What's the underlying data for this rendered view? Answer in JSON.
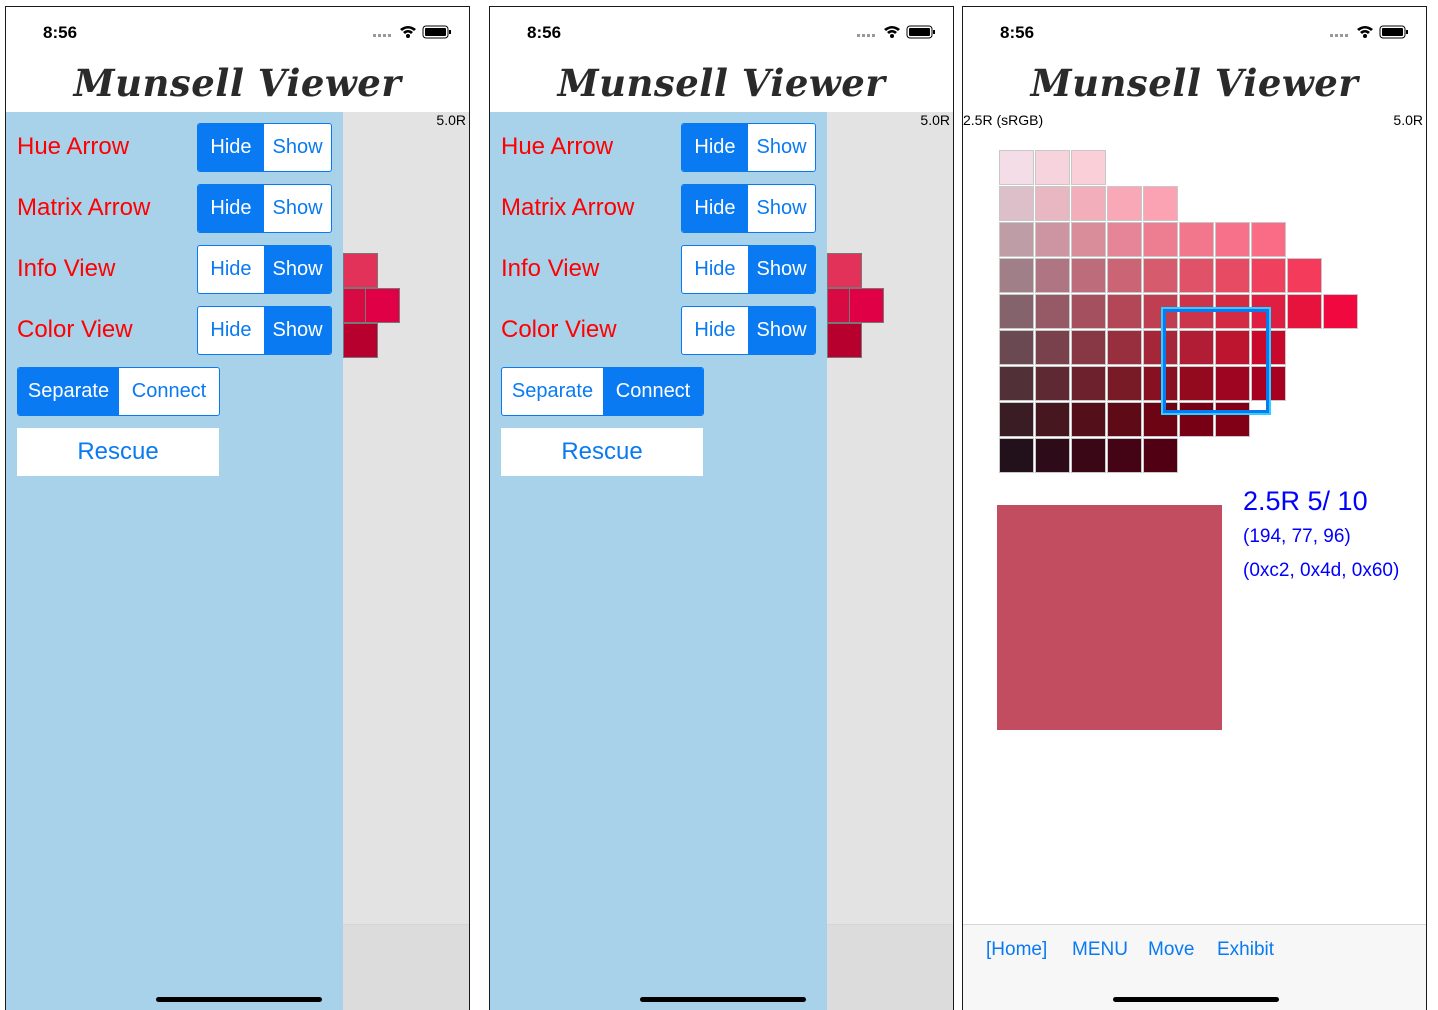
{
  "status": {
    "time": "8:56"
  },
  "app": {
    "title": "Munsell Viewer"
  },
  "hue": {
    "current": "5.0R",
    "left_label": "2.5R (sRGB)"
  },
  "settings": {
    "rows": [
      {
        "label": "Hue Arrow",
        "hide": "Hide",
        "show": "Show",
        "selected": "hide"
      },
      {
        "label": "Matrix Arrow",
        "hide": "Hide",
        "show": "Show",
        "selected": "hide"
      },
      {
        "label": "Info View",
        "hide": "Hide",
        "show": "Show",
        "selected": "show"
      },
      {
        "label": "Color View",
        "hide": "Hide",
        "show": "Show",
        "selected": "show"
      }
    ],
    "mode": {
      "separate": "Separate",
      "connect": "Connect"
    },
    "rescue": "Rescue"
  },
  "screen1": {
    "mode_selected": "separate"
  },
  "screen2": {
    "mode_selected": "connect"
  },
  "info": {
    "notation": "2.5R 5/ 10",
    "rgb": "(194, 77, 96)",
    "hex": "(0xc2, 0x4d, 0x60)",
    "swatch_color": "#c24d60"
  },
  "tabs": {
    "home": "[Home]",
    "menu": "MENU",
    "move": "Move",
    "exhibit": "Exhibit"
  },
  "colors": {
    "accent": "#0a7af2",
    "panel": "#a8d2ea",
    "label_red": "#ff0000",
    "info_blue": "#0000ff"
  }
}
